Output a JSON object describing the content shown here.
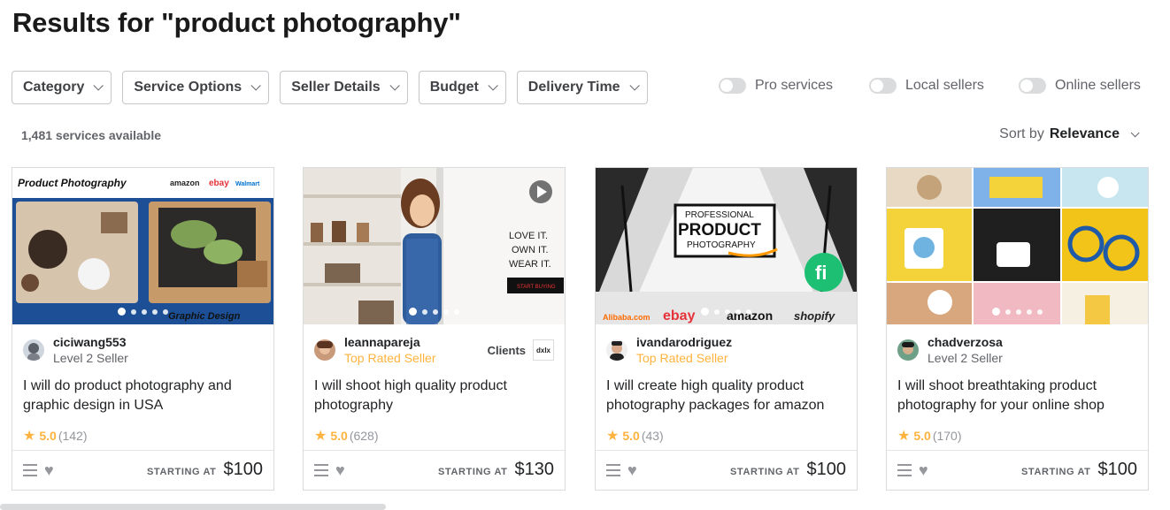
{
  "page": {
    "title": "Results for \"product photography\"",
    "count": "1,481 services available",
    "sort_label": "Sort by",
    "sort_value": "Relevance"
  },
  "filters": [
    {
      "label": "Category"
    },
    {
      "label": "Service Options"
    },
    {
      "label": "Seller Details"
    },
    {
      "label": "Budget"
    },
    {
      "label": "Delivery Time"
    }
  ],
  "toggles": [
    {
      "label": "Pro services",
      "on": false
    },
    {
      "label": "Local sellers",
      "on": false
    },
    {
      "label": "Online sellers",
      "on": false
    }
  ],
  "cards": [
    {
      "seller": "ciciwang553",
      "level": "Level 2 Seller",
      "title": "I will do product photography and graphic design in USA",
      "rating": "5.0",
      "reviews": "(142)",
      "starting": "STARTING AT",
      "price": "$100",
      "image": {
        "banner": "Product Photography",
        "brands": [
          "amazon",
          "ebay",
          "Walmart"
        ],
        "caption": "Graphic Design"
      }
    },
    {
      "seller": "leannapareja",
      "level": "Top Rated Seller",
      "clients": "Clients",
      "clients_logo": "dxlx",
      "title": "I will shoot high quality product photography",
      "rating": "5.0",
      "reviews": "(628)",
      "starting": "STARTING AT",
      "price": "$130",
      "image": {
        "tagline": [
          "LOVE IT.",
          "OWN IT.",
          "WEAR IT."
        ],
        "button": "START BUYING"
      }
    },
    {
      "seller": "ivandarodriguez",
      "level": "Top Rated Seller",
      "title": "I will create high quality product photography packages for amazon",
      "rating": "5.0",
      "reviews": "(43)",
      "starting": "STARTING AT",
      "price": "$100",
      "image": {
        "sign": [
          "PROFESSIONAL",
          "PRODUCT",
          "PHOTOGRAPHY"
        ],
        "badge": "fi",
        "brands": [
          "Alibaba.com",
          "ebay",
          "amazon",
          "shopify"
        ]
      }
    },
    {
      "seller": "chadverzosa",
      "level": "Level 2 Seller",
      "title": "I will shoot breathtaking product photography for your online shop",
      "rating": "5.0",
      "reviews": "(170)",
      "starting": "STARTING AT",
      "price": "$100"
    }
  ],
  "colors": {
    "star": "#ffb33e",
    "top_rated": "#ffb33e",
    "fiverr_green": "#1dbf73"
  }
}
